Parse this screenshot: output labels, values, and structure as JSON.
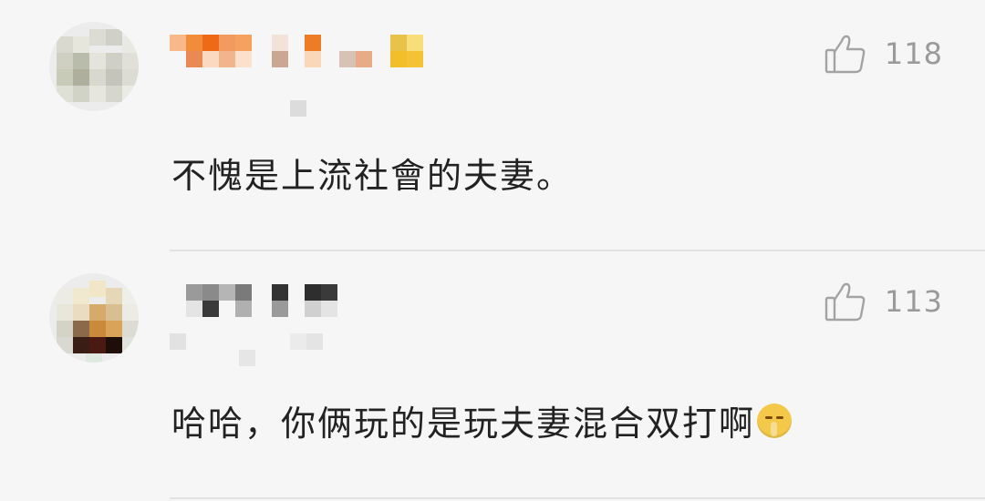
{
  "comments": [
    {
      "likes": "118",
      "text": "不愧是上流社會的夫妻。",
      "icons": {
        "like": "thumb-up-icon"
      }
    },
    {
      "likes": "113",
      "text": "哈哈，你俩玩的是玩夫妻混合双打啊",
      "icons": {
        "like": "thumb-up-icon",
        "emoji": "shushing-face-emoji-icon"
      }
    }
  ]
}
